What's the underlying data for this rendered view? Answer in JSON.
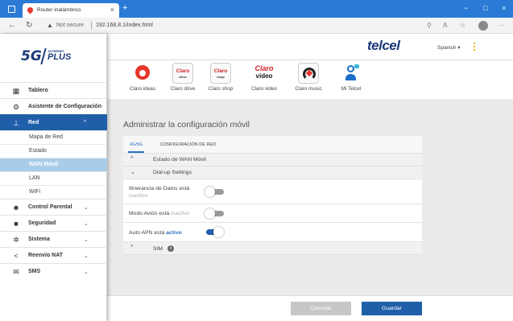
{
  "browser": {
    "tab_title": "Router inalámbrico",
    "tab_close": "×",
    "new_tab": "+",
    "not_secure": "Not secure",
    "url": "192.168.8.1/index.html",
    "minimize": "−",
    "maximize": "□",
    "close": "×"
  },
  "brand": {
    "logo_main": "5G",
    "logo_top": "INTERNET",
    "logo_plus": "PLUS",
    "operator": "telcel"
  },
  "header": {
    "language": "Spanish ▾"
  },
  "sidebar": {
    "items": [
      {
        "label": "Tablero",
        "icon": "dashboard-icon"
      },
      {
        "label": "Asistente de Configuración",
        "icon": "gears-icon"
      },
      {
        "label": "Red",
        "icon": "network-icon",
        "chevron": "^",
        "active": true
      },
      {
        "label": "Control Parental",
        "icon": "family-icon",
        "chevron": "⌄"
      },
      {
        "label": "Seguridad",
        "icon": "lock-icon",
        "chevron": "⌄"
      },
      {
        "label": "Sistema",
        "icon": "gear-icon",
        "chevron": "⌄"
      },
      {
        "label": "Reenvío NAT",
        "icon": "share-icon",
        "chevron": "⌄"
      },
      {
        "label": "SMS",
        "icon": "mail-icon",
        "chevron": "⌄"
      }
    ],
    "red_subitems": [
      "Mapa de Red",
      "Estado",
      "WAN Móvil",
      "LAN",
      "WiFi"
    ],
    "selected_subitem": "WAN Móvil"
  },
  "apps": [
    {
      "label": "Claro ideas",
      "icon_text": "",
      "icon_sub": ""
    },
    {
      "label": "Claro drive",
      "icon_text": "Claro",
      "icon_sub": "drive"
    },
    {
      "label": "Claro shop",
      "icon_text": "Claro",
      "icon_sub": "shop"
    },
    {
      "label": "Claro video",
      "icon_text": "Claro",
      "icon_sub": "video"
    },
    {
      "label": "Claro music",
      "icon_text": "",
      "icon_sub": ""
    },
    {
      "label": "Mi Telcel",
      "icon_text": "",
      "icon_sub": ""
    }
  ],
  "main": {
    "title": "Administrar la configuración móvil",
    "tabs": [
      "4G/5G",
      "CONFIGURACIÓN DE RED"
    ],
    "sections": {
      "wan_status": {
        "chevron": "^",
        "label": "Estado de WAN Móvil"
      },
      "dialup": {
        "chevron": "⌄",
        "label": "Dial-up Settings"
      },
      "sim": {
        "chevron": "^",
        "label": "SIM"
      }
    },
    "roaming": {
      "label": "Itinerancia de Datos está",
      "state": "inactivo",
      "on": false
    },
    "airplane": {
      "label": "Modo Avión está",
      "state": "inactivo",
      "on": false
    },
    "auto_apn": {
      "label": "Auto APN está",
      "state": "activo",
      "on": true
    }
  },
  "footer": {
    "cancel": "Cancelar",
    "save": "Guardar"
  },
  "colors": {
    "accent": "#1f5fa9",
    "browser_bar": "#2b7bd6",
    "selected_sub": "#a9cde8",
    "link": "#2a6fc0"
  }
}
